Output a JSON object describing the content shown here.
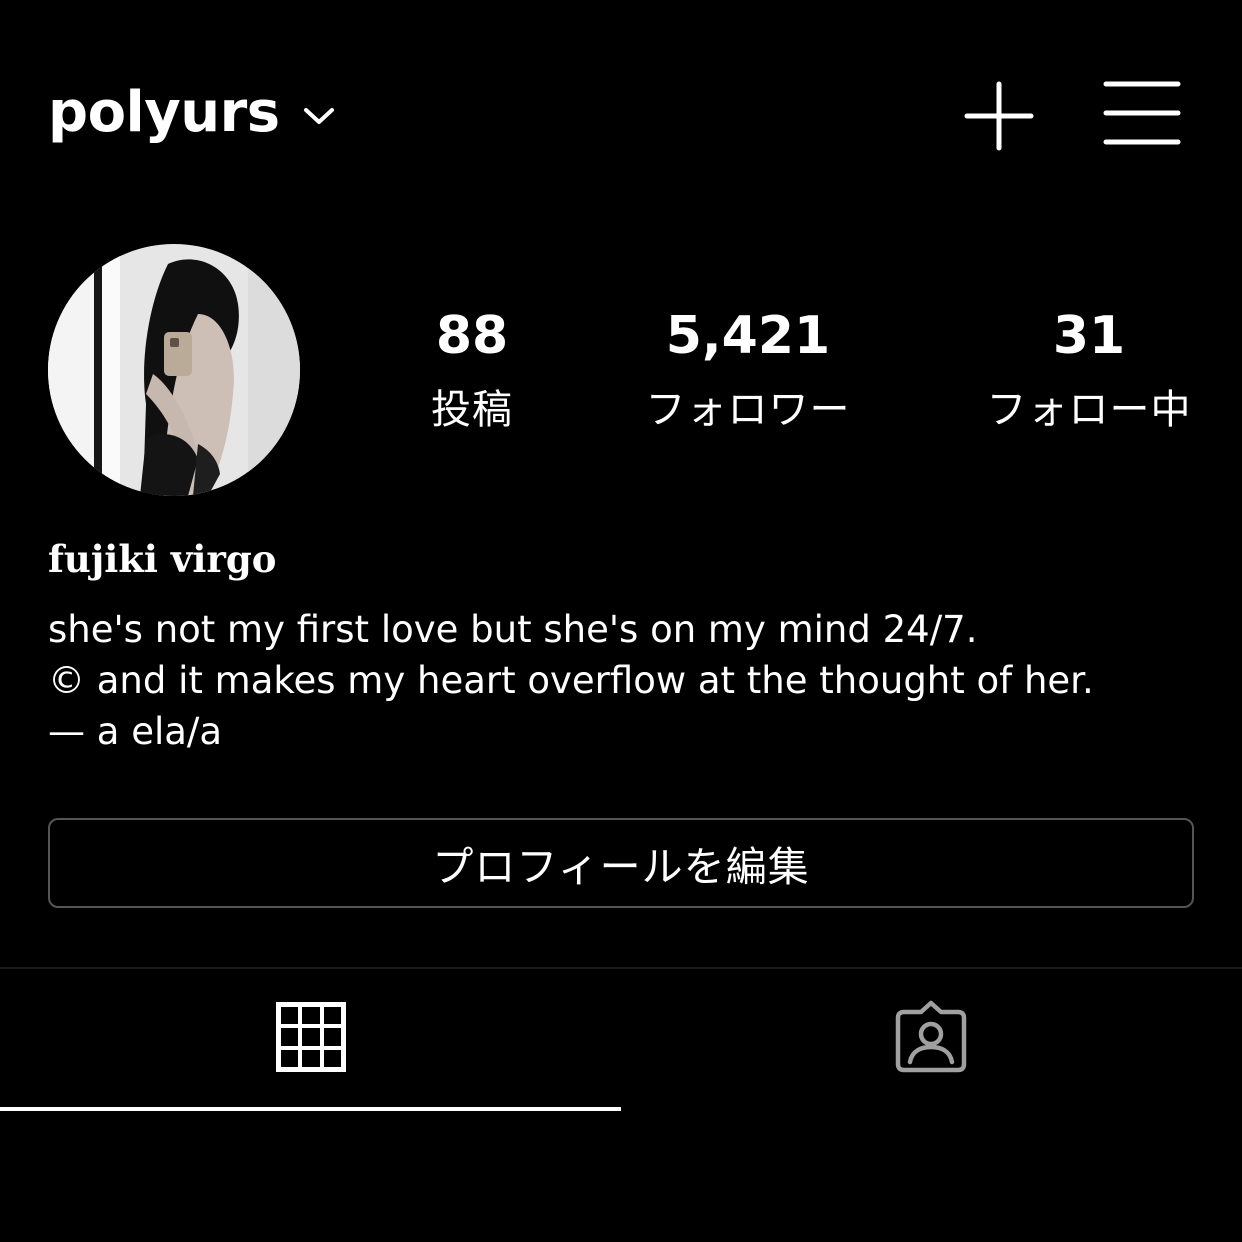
{
  "header": {
    "username": "polyurs",
    "icons": [
      "chevron-down-icon",
      "plus-icon",
      "menu-icon"
    ]
  },
  "stats": {
    "posts": {
      "count": "88",
      "label": "投稿"
    },
    "followers": {
      "count": "5,421",
      "label": "フォロワー"
    },
    "following": {
      "count": "31",
      "label": "フォロー中"
    }
  },
  "profile": {
    "display_name": "fujiki virgo",
    "bio": [
      "she's not my first love but she's on my mind 24/7.",
      "© and it makes my heart overflow at the thought of her.",
      "— a ela/a"
    ]
  },
  "edit_profile": {
    "label": "プロフィールを編集"
  },
  "tabs": [
    {
      "name": "grid",
      "icon": "grid-icon",
      "active": true
    },
    {
      "name": "tagged",
      "icon": "tagged-person-icon",
      "active": false
    }
  ],
  "colors": {
    "background": "#000000",
    "text": "#ffffff",
    "border": "#555555",
    "inactive_icon": "#a0a0a0"
  }
}
